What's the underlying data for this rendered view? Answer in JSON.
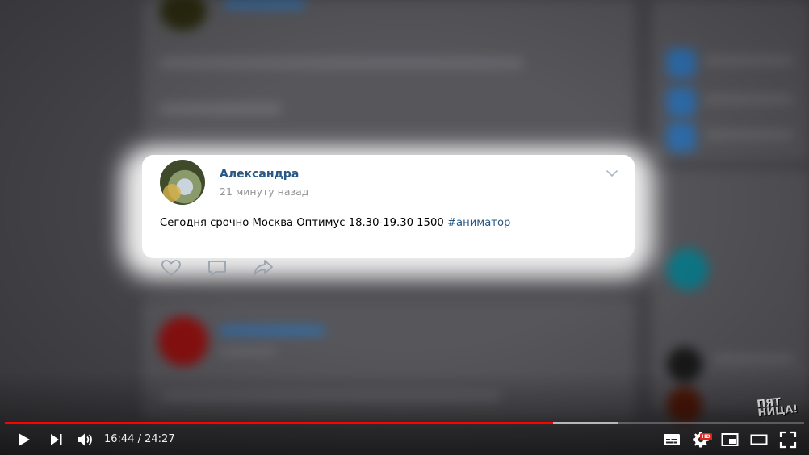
{
  "post": {
    "author": "Александра",
    "time": "21 минуту назад",
    "text": "Сегодня срочно Москва Оптимус 18.30-19.30 1500",
    "hashtag": "#аниматор"
  },
  "icons": {
    "expand": "chevron-down-icon",
    "like": "heart-icon",
    "comment": "comment-icon",
    "share": "share-icon"
  },
  "channel_logo": "ПЯТ НИЦА!",
  "player": {
    "current_time": "16:44",
    "separator": " / ",
    "duration": "24:27",
    "played_fraction": 0.686,
    "loaded_fraction": 0.767,
    "hd_badge": "HD"
  },
  "colors": {
    "progress_played": "#ff0000",
    "link": "#2a5885",
    "hd_badge": "#e62117"
  }
}
